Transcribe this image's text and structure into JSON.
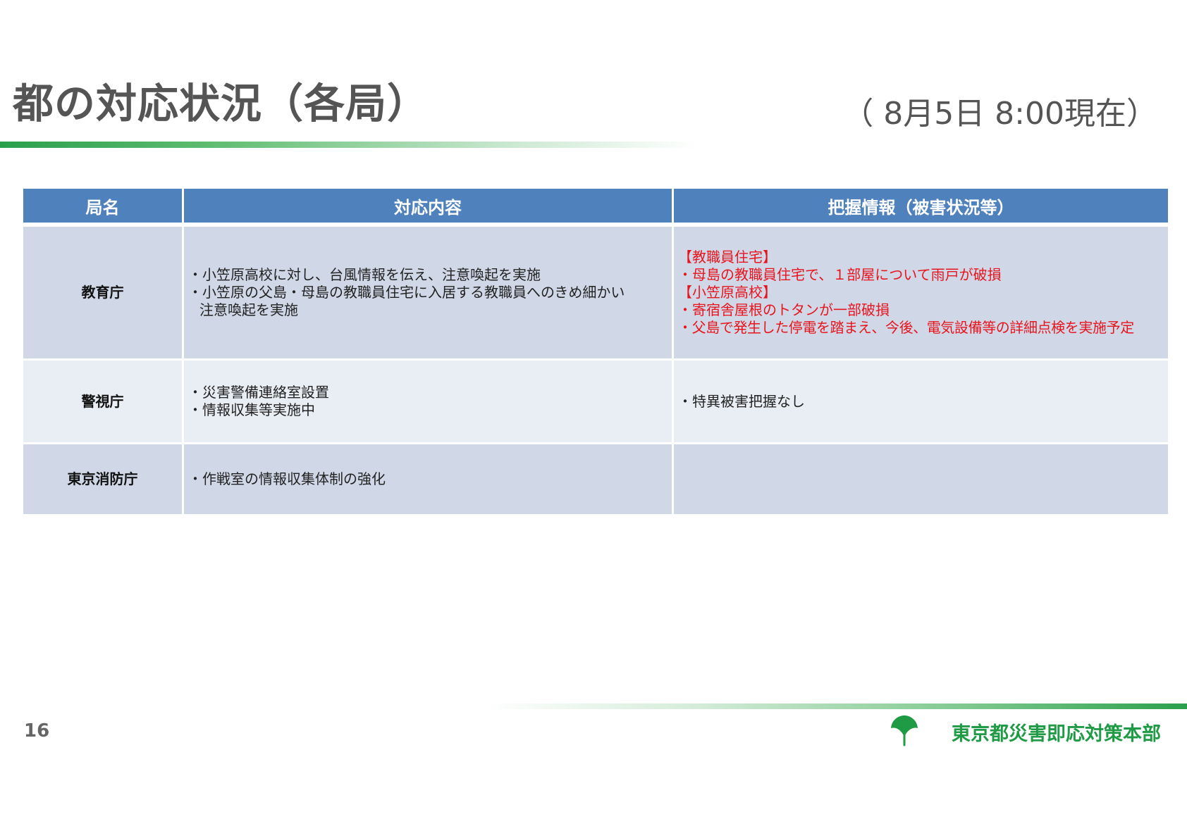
{
  "header": {
    "title": "都の対応状況（各局）",
    "as_of": "（ 8月5日 8:00現在）"
  },
  "table": {
    "columns": [
      "局名",
      "対応内容",
      "把握情報（被害状況等）"
    ],
    "rows": [
      {
        "bureau": "教育庁",
        "actions": [
          "・小笠原高校に対し、台風情報を伝え、注意喚起を実施",
          "・小笠原の父島・母島の教職員住宅に入居する教職員へのきめ細かい",
          "注意喚起を実施"
        ],
        "info": [
          "【教職員住宅】",
          "・母島の教職員住宅で、１部屋について雨戸が破損",
          "【小笠原高校】",
          "・寄宿舎屋根のトタンが一部破損",
          "・父島で発生した停電を踏まえ、今後、電気設備等の詳細点検を実施予定"
        ],
        "info_color": "#e8141c"
      },
      {
        "bureau": "警視庁",
        "actions": [
          "・災害警備連絡室設置",
          "・情報収集等実施中"
        ],
        "info": [
          "・特異被害把握なし"
        ]
      },
      {
        "bureau": "東京消防庁",
        "actions": [
          "・作戦室の情報収集体制の強化"
        ],
        "info": []
      }
    ]
  },
  "footer": {
    "page_number": "16",
    "organization": "東京都災害即応対策本部",
    "logo_icon": "tokyo-ginkgo-logo-icon"
  },
  "colors": {
    "header_fill": "#4f81bd",
    "row_fill_dark": "#d0d8e8",
    "row_fill_light": "#e9edf4",
    "accent_green": "#2aa04c",
    "alert_red": "#e8141c"
  }
}
